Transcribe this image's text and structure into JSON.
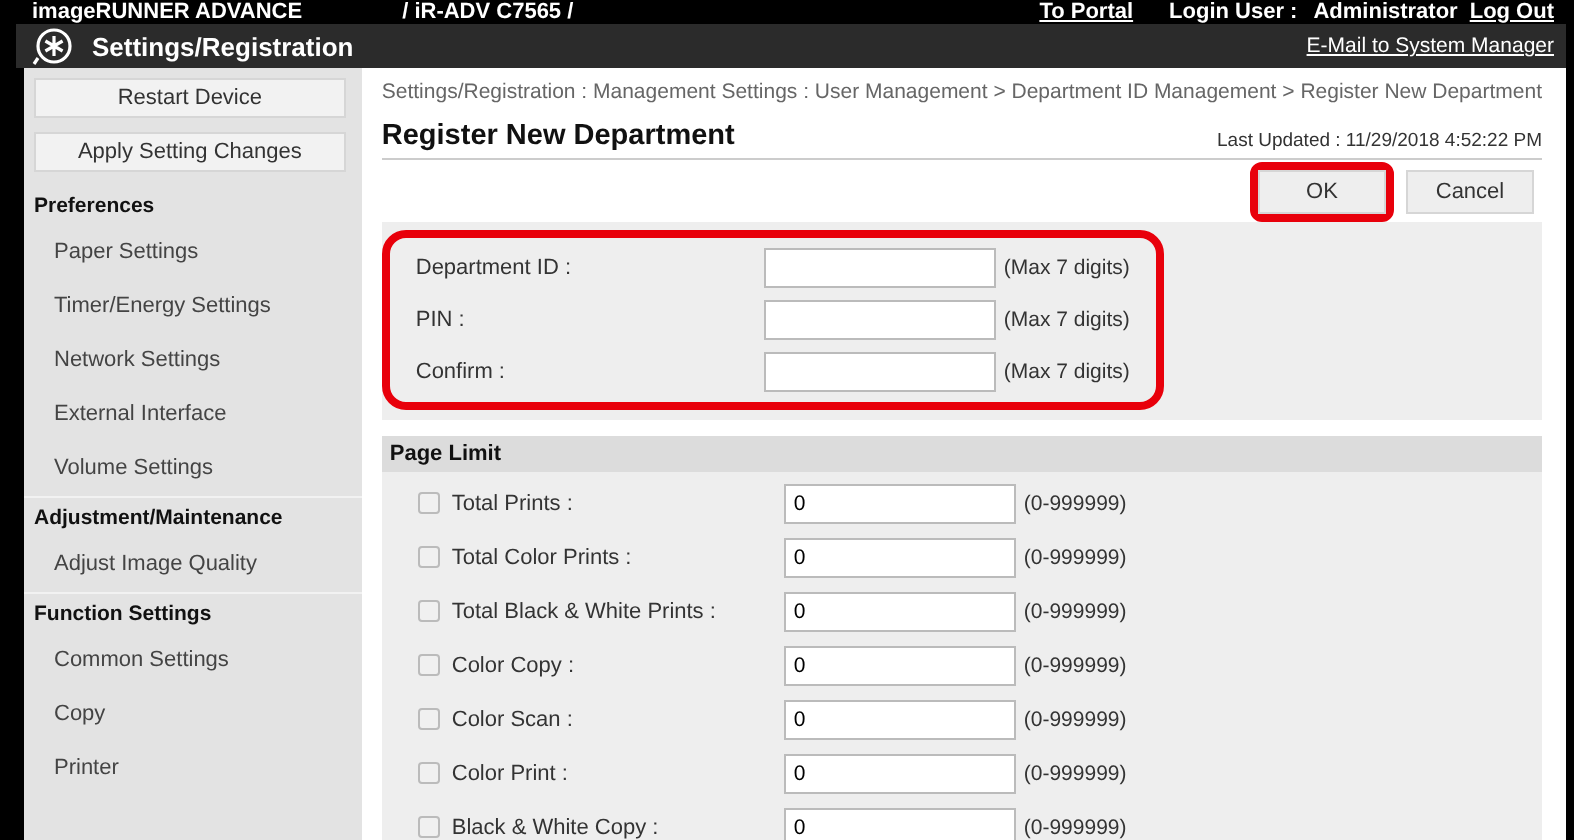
{
  "header": {
    "product": "imageRUNNER ADVANCE",
    "device": "/ iR-ADV C7565 /",
    "portal_link": "To Portal",
    "login_label": "Login User :",
    "login_user": "Administrator",
    "logout_link": "Log Out"
  },
  "subheader": {
    "title": "Settings/Registration",
    "email_link": "E-Mail to System Manager"
  },
  "sidebar": {
    "buttons": [
      "Restart Device",
      "Apply Setting Changes"
    ],
    "sections": [
      {
        "title": "Preferences",
        "items": [
          "Paper Settings",
          "Timer/Energy Settings",
          "Network Settings",
          "External Interface",
          "Volume Settings"
        ]
      },
      {
        "title": "Adjustment/Maintenance",
        "items": [
          "Adjust Image Quality"
        ]
      },
      {
        "title": "Function Settings",
        "items": [
          "Common Settings",
          "Copy",
          "Printer"
        ]
      }
    ]
  },
  "breadcrumb": "Settings/Registration : Management Settings : User Management > Department ID Management > Register New Department",
  "page_title": "Register New Department",
  "last_updated": "Last Updated : 11/29/2018 4:52:22 PM",
  "actions": [
    {
      "label": "OK",
      "highlighted": true
    },
    {
      "label": "Cancel",
      "highlighted": false
    }
  ],
  "department_form": {
    "highlighted": true,
    "fields": [
      {
        "label": "Department ID :",
        "hint": "(Max 7 digits)"
      },
      {
        "label": "PIN :",
        "hint": "(Max 7 digits)"
      },
      {
        "label": "Confirm :",
        "hint": "(Max 7 digits)"
      }
    ]
  },
  "page_limit": {
    "title": "Page Limit",
    "items": [
      {
        "label": "Total Prints :",
        "checked": false,
        "value": "0",
        "hint": "(0-999999)"
      },
      {
        "label": "Total Color Prints :",
        "checked": false,
        "value": "0",
        "hint": "(0-999999)"
      },
      {
        "label": "Total Black & White Prints :",
        "checked": false,
        "value": "0",
        "hint": "(0-999999)"
      },
      {
        "label": "Color Copy :",
        "checked": false,
        "value": "0",
        "hint": "(0-999999)"
      },
      {
        "label": "Color Scan :",
        "checked": false,
        "value": "0",
        "hint": "(0-999999)"
      },
      {
        "label": "Color Print :",
        "checked": false,
        "value": "0",
        "hint": "(0-999999)"
      },
      {
        "label": "Black & White Copy :",
        "checked": false,
        "value": "0",
        "hint": "(0-999999)"
      }
    ]
  }
}
